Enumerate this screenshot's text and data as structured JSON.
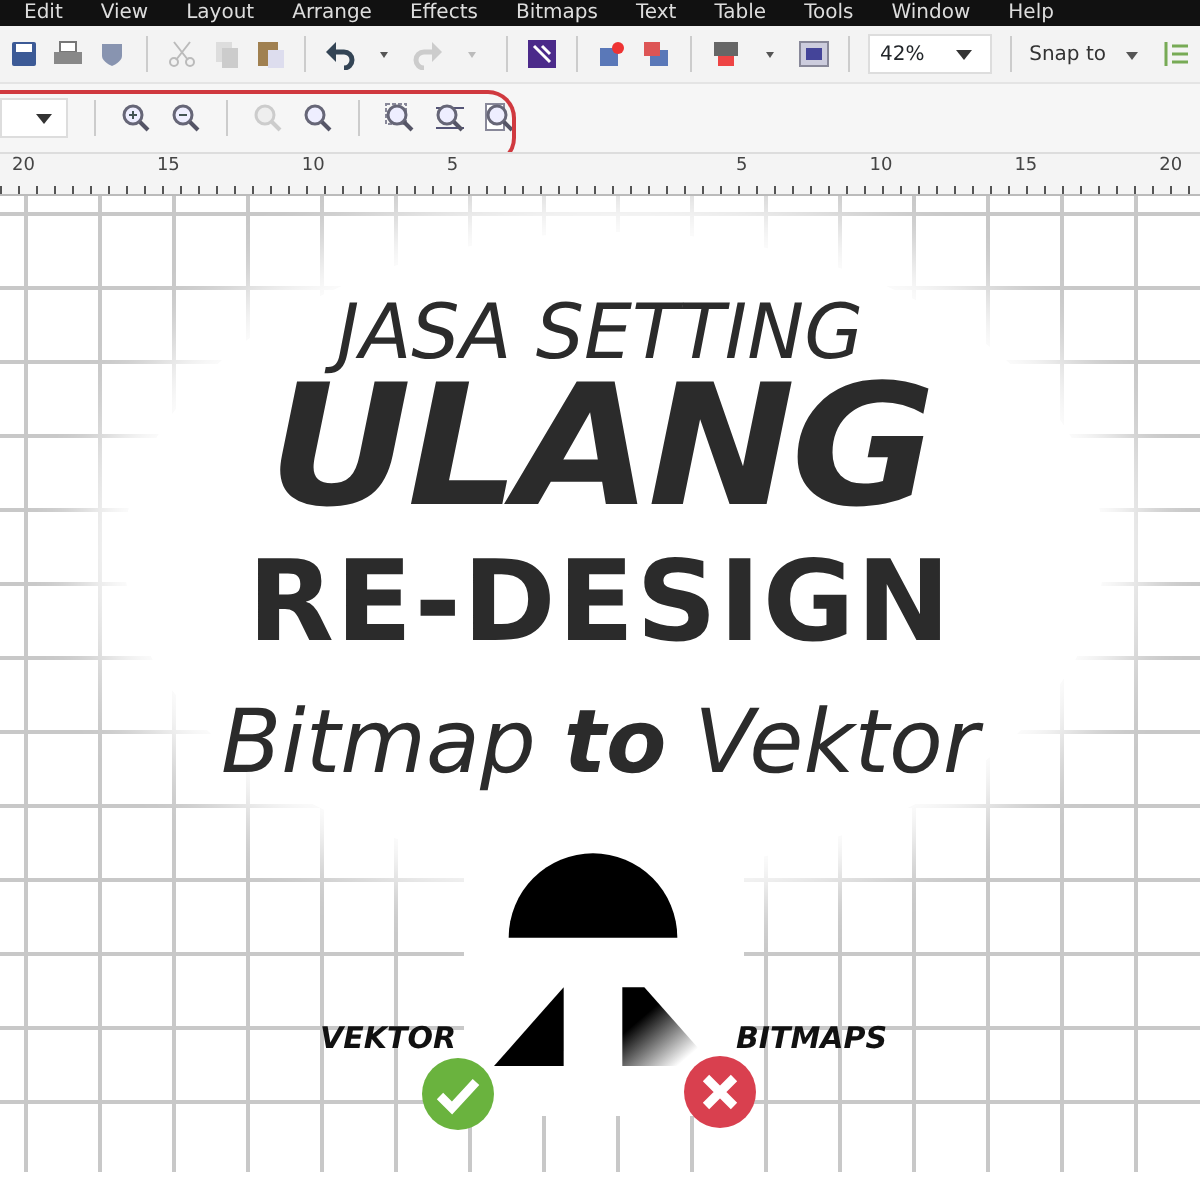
{
  "menu_bar": {
    "items": [
      "Edit",
      "View",
      "Layout",
      "Arrange",
      "Effects",
      "Bitmaps",
      "Text",
      "Table",
      "Tools",
      "Window",
      "Help"
    ]
  },
  "toolbar": {
    "zoom_level": "42%",
    "snap_label": "Snap to"
  },
  "ruler": {
    "left_labels": [
      "20",
      "15",
      "10",
      "5"
    ],
    "right_labels": [
      "5",
      "10",
      "15",
      "20"
    ]
  },
  "canvas": {
    "headline": [
      "JASA SETTING",
      "ULANG",
      "RE-DESIGN",
      "Bitmap **to** Vektor"
    ],
    "left_label": "VEKTOR",
    "right_label": "BITMAPS"
  }
}
